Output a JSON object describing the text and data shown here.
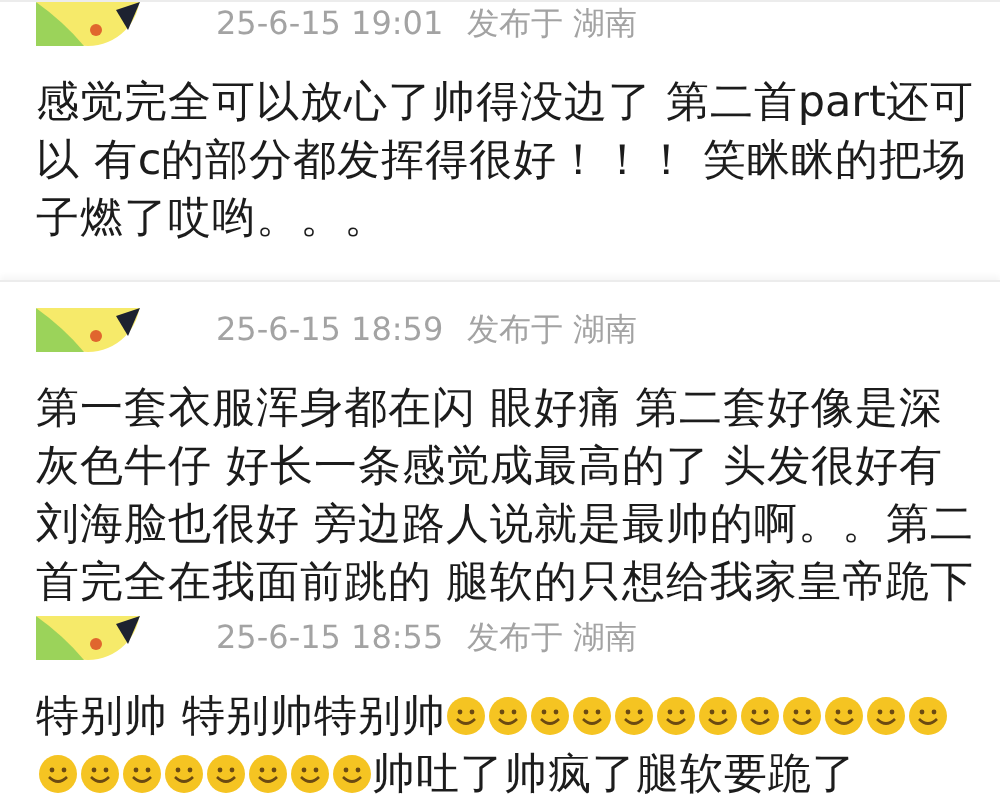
{
  "comments": [
    {
      "time": "25-6-15 19:01",
      "location": "发布于 湖南",
      "body": [
        {
          "kind": "text",
          "text": "感觉完全可以放心了帅得没边了 第二首part还可以 有c的部分都发挥得很好！！！ 笑眯眯的把场子燃了哎哟。。。"
        }
      ]
    },
    {
      "time": "25-6-15 18:59",
      "location": "发布于 湖南",
      "body": [
        {
          "kind": "text",
          "text": "第一套衣服浑身都在闪 眼好痛 第二套好像是深灰色牛仔 好长一条感觉成最高的了 头发很好有刘海脸也很好 旁边路人说就是最帅的啊。。第二首完全在我面前跳的 腿软的只想给我家皇帝跪下"
        }
      ]
    },
    {
      "time": "25-6-15 18:55",
      "location": "发布于 湖南",
      "body": [
        {
          "kind": "text",
          "text": "特别帅 特别帅特别帅"
        },
        {
          "kind": "emoji"
        },
        {
          "kind": "emoji"
        },
        {
          "kind": "emoji"
        },
        {
          "kind": "emoji"
        },
        {
          "kind": "emoji"
        },
        {
          "kind": "emoji"
        },
        {
          "kind": "emoji"
        },
        {
          "kind": "emoji"
        },
        {
          "kind": "emoji"
        },
        {
          "kind": "emoji"
        },
        {
          "kind": "emoji"
        },
        {
          "kind": "emoji"
        },
        {
          "kind": "emoji"
        },
        {
          "kind": "emoji"
        },
        {
          "kind": "emoji"
        },
        {
          "kind": "emoji"
        },
        {
          "kind": "emoji"
        },
        {
          "kind": "emoji"
        },
        {
          "kind": "emoji"
        },
        {
          "kind": "emoji"
        },
        {
          "kind": "text",
          "text": "帅吐了帅疯了腿软要跪了"
        }
      ]
    }
  ]
}
